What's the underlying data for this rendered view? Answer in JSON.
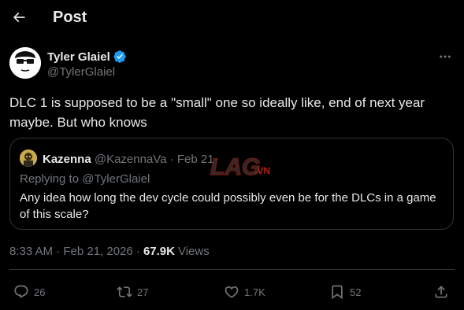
{
  "header": {
    "title": "Post"
  },
  "post": {
    "author_name": "Tyler Glaiel",
    "author_handle": "@TylerGlaiel",
    "text": "DLC 1 is supposed to be a \"small\" one so ideally like, end of next year maybe. But who knows",
    "time": "8:33 AM · Feb 21, 2026 ·",
    "views_count": "67.9K",
    "views_label": "Views"
  },
  "quote": {
    "author_name": "Kazenna",
    "author_meta": "@KazennaVa · Feb 21",
    "replying_to": "Replying to @TylerGlaiel",
    "text": "Any idea how long the dev cycle could possibly even be for the DLCs in a game of this scale?"
  },
  "watermark": {
    "text_main": "LAG",
    "text_suffix": ".VN"
  },
  "actions": {
    "replies": "26",
    "reposts": "27",
    "likes": "1.7K",
    "bookmarks": "52"
  },
  "colors": {
    "background": "#000000",
    "text": "#e7e9ea",
    "secondary": "#71767b",
    "border": "#2f3336",
    "verified": "#1d9bf0"
  }
}
